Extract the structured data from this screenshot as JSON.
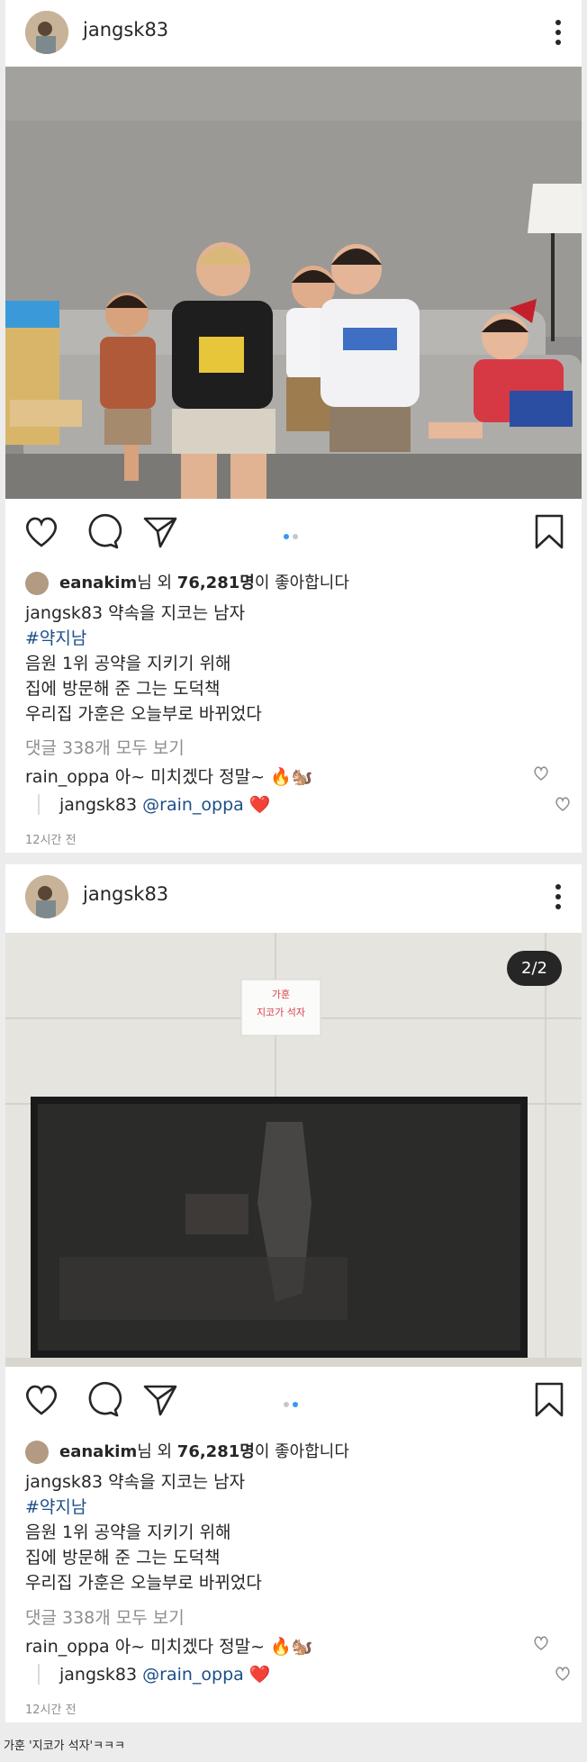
{
  "posts": [
    {
      "username": "jangsk83",
      "counter": "",
      "liked_by": "eanakim",
      "likes_mid": "님 외 ",
      "likes_count": "76,281명",
      "likes_tail": "이 좋아합니다",
      "caption_user": "jangsk83",
      "caption_text": " 약속을 지코는 남자",
      "hashtag": "#약지남",
      "lines": [
        "음원 1위 공약을 지키기 위해",
        "집에 방문해 준 그는 도덕책",
        "우리집 가훈은 오늘부로 바뀌었다"
      ],
      "view_all": "댓글 338개 모두 보기",
      "comment_user": "rain_oppa",
      "comment_text": " 아~ 미치겠다 정말~ 🔥🐿️",
      "reply_user": "jangsk83",
      "reply_mention": "@rain_oppa",
      "reply_emoji": " ❤️",
      "time": "12시간 전",
      "active_dot": 0
    },
    {
      "username": "jangsk83",
      "counter": "2/2",
      "sign_text": [
        "가훈",
        "지코가 석자"
      ],
      "liked_by": "eanakim",
      "likes_mid": "님 외 ",
      "likes_count": "76,281명",
      "likes_tail": "이 좋아합니다",
      "caption_user": "jangsk83",
      "caption_text": " 약속을 지코는 남자",
      "hashtag": "#약지남",
      "lines": [
        "음원 1위 공약을 지키기 위해",
        "집에 방문해 준 그는 도덕책",
        "우리집 가훈은 오늘부로 바뀌었다"
      ],
      "view_all": "댓글 338개 모두 보기",
      "comment_user": "rain_oppa",
      "comment_text": " 아~ 미치겠다 정말~ 🔥🐿️",
      "reply_user": "jangsk83",
      "reply_mention": "@rain_oppa",
      "reply_emoji": " ❤️",
      "time": "12시간 전",
      "active_dot": 1
    }
  ],
  "footer_caption": "가훈 '지코가 석자'ㅋㅋㅋ",
  "colors": {
    "dot_active": "#3897f0",
    "dot_inactive": "#c7c7c7",
    "mention": "#1c4e8a",
    "reply_heart": "#ed4956"
  },
  "icons": [
    "more-vertical-icon",
    "heart-icon",
    "comment-icon",
    "share-icon",
    "bookmark-icon",
    "small-heart-icon"
  ]
}
